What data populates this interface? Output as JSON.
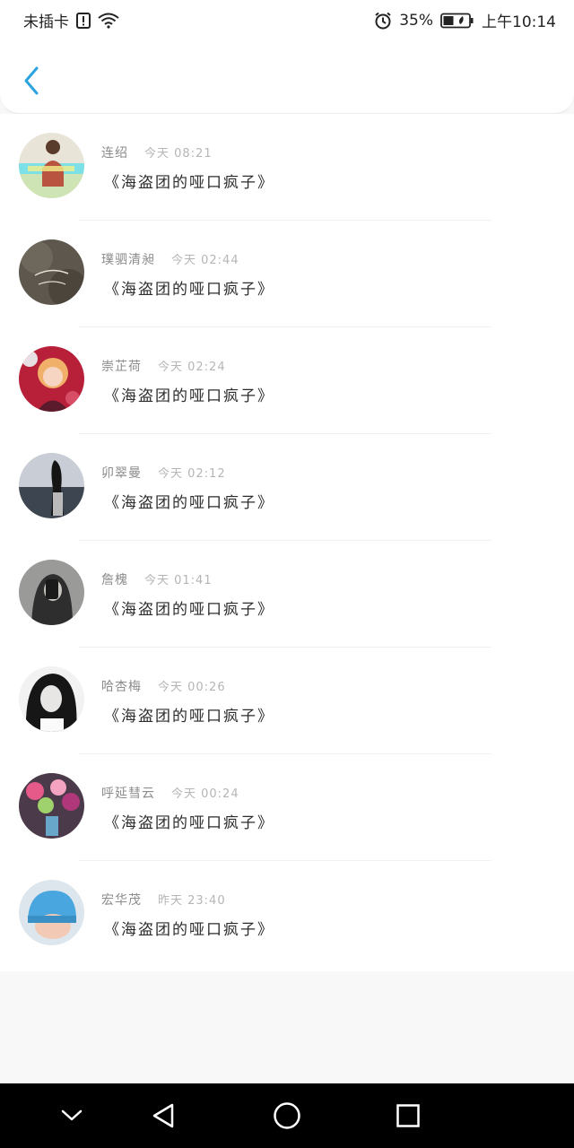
{
  "status_bar": {
    "carrier": "未插卡",
    "battery_percent": "35%",
    "time": "上午10:14"
  },
  "header": {
    "back_icon": "chevron-left-icon",
    "accent_color": "#2aa3e0"
  },
  "messages": [
    {
      "name": "连绍",
      "time": "今天 08:21",
      "text": "《海盗团的哑口疯子》"
    },
    {
      "name": "璞驷清昶",
      "time": "今天 02:44",
      "text": "《海盗团的哑口疯子》"
    },
    {
      "name": "崇芷荷",
      "time": "今天 02:24",
      "text": "《海盗团的哑口疯子》"
    },
    {
      "name": "卯翠曼",
      "time": "今天 02:12",
      "text": "《海盗团的哑口疯子》"
    },
    {
      "name": "詹槐",
      "time": "今天 01:41",
      "text": "《海盗团的哑口疯子》"
    },
    {
      "name": "哈杏梅",
      "time": "今天 00:26",
      "text": "《海盗团的哑口疯子》"
    },
    {
      "name": "呼延彗云",
      "time": "今天 00:24",
      "text": "《海盗团的哑口疯子》"
    },
    {
      "name": "宏华茂",
      "time": "昨天 23:40",
      "text": "《海盗团的哑口疯子》"
    }
  ],
  "nav_bar": {
    "icons": [
      "chevron-down-icon",
      "back-triangle-icon",
      "home-circle-icon",
      "recents-square-icon"
    ]
  }
}
